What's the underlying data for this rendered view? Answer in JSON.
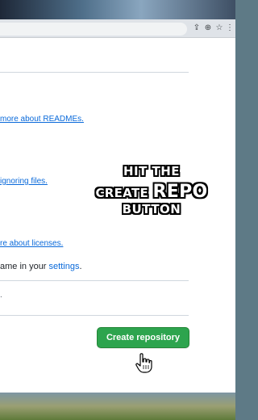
{
  "browser": {
    "toolbar_icons": [
      "share-icon",
      "zoom-icon",
      "bookmark-star-icon",
      "menu-dots-icon"
    ],
    "toolbar_glyphs": [
      "⇪",
      "⊕",
      "☆",
      "⋮"
    ]
  },
  "content": {
    "readme_link": "more about READMEs.",
    "gitignore_link": "ignoring files.",
    "license_link": "re about licenses.",
    "settings_prefix": "ame in your ",
    "settings_link": "settings",
    "settings_suffix": ".",
    "stray_char": "."
  },
  "actions": {
    "create_button": "Create repository"
  },
  "overlay": {
    "line1": "HIT THE",
    "line2_a": "CREATE ",
    "line2_b": "REPO",
    "line3": "BUTTON"
  },
  "colors": {
    "link": "#0969da",
    "button": "#2da44e",
    "button_text": "#ffffff"
  }
}
